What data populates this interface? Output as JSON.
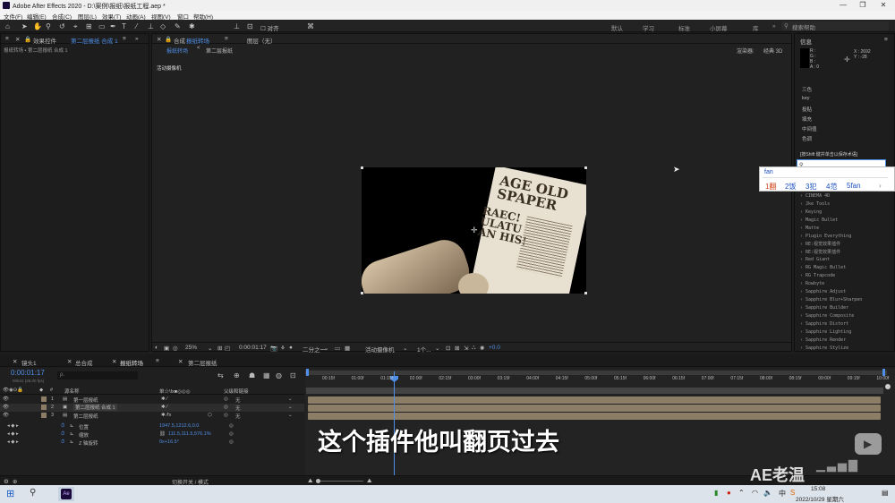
{
  "app": {
    "title": "Adobe After Effects 2020 - D:\\案例\\报纸\\报纸工程.aep *"
  },
  "window_controls": {
    "min": "—",
    "max": "❐",
    "close": "✕"
  },
  "menu": [
    "文件(F)",
    "编辑(E)",
    "合成(C)",
    "图层(L)",
    "效果(T)",
    "动画(A)",
    "视图(V)",
    "窗口",
    "帮助(H)"
  ],
  "toolbar": {
    "snap_label": "对齐",
    "workspaces": [
      "默认",
      "学习",
      "标准",
      "小屏幕",
      "库"
    ],
    "search_help": "搜索帮助"
  },
  "left_panel": {
    "tab": "效果控件",
    "tab_comp": "第二层报纸 合成 1",
    "breadcrumb": "报纸转场 • 第二层报纸 合成 1"
  },
  "comp_panel": {
    "tab_prefix": "合成",
    "tab_name": "报纸转场",
    "layer_tab": "图层（无）",
    "subtabs": [
      "报纸转场",
      "第二层报纸"
    ],
    "renderer_label": "渲染器:",
    "renderer_value": "经典 3D",
    "active_camera": "活动摄像机",
    "paper_lines": [
      "AGE OLD",
      "SPAPER",
      "RAEC!",
      "ULATU",
      "AN HIS!"
    ]
  },
  "viewer_controls": {
    "zoom": "25%",
    "timecode": "0:00:01:17",
    "resolution": "二分之一",
    "camera": "活动摄像机",
    "views": "1个...",
    "exposure": "+0.0"
  },
  "right_panel": {
    "title": "信息",
    "r": "R :",
    "g": "G :",
    "b": "B :",
    "a": "A : 0",
    "x": "X : 2692",
    "y": "Y : -28",
    "items": [
      "三色",
      "key",
      "投贴",
      "填充",
      "中间值",
      "色调"
    ],
    "hint": "[按Shift 键并单击以保存术语]"
  },
  "ime": {
    "input": "fan",
    "candidates": [
      "1翻",
      "2饭",
      "3犯",
      "4范",
      "5fan"
    ]
  },
  "effects_list": [
    "CINEMA 4D",
    "Jke Tools",
    "Keying",
    "Magic Bullet",
    "Matte",
    "Plugin Everything",
    "RE:视觉效果插件",
    "RE:视觉效果插件",
    "Red Giant",
    "RG Magic Bullet",
    "RG Trapcode",
    "Rowbyte",
    "Sapphire Adjust",
    "Sapphire Blur+Sharpen",
    "Sapphire Builder",
    "Sapphire Composite",
    "Sapphire Distort",
    "Sapphire Lighting",
    "Sapphire Render",
    "Sapphire Stylize"
  ],
  "timeline": {
    "tabs": [
      "镜头1",
      "总合成",
      "报纸转场",
      "第二层报纸"
    ],
    "timecode": "0:00:01:17",
    "fps": "00041 (25.00 fps)",
    "search_placeholder": "ρ.",
    "col_name": "源名称",
    "col_switches": "单☆\\fx■◎◎◎",
    "col_parent": "父级和链接",
    "layers": [
      {
        "num": "1",
        "name": "第一层报纸",
        "parent": "无"
      },
      {
        "num": "2",
        "name": "第二层报纸 合成 1",
        "parent": "无"
      },
      {
        "num": "3",
        "name": "第二层报纸",
        "parent": "无"
      }
    ],
    "props": [
      {
        "name": "位置",
        "value": "1947.5,1212.6,0.0"
      },
      {
        "name": "缩放",
        "value": "111.5,111.5,576.1%"
      },
      {
        "name": "Z 轴旋转",
        "value": "0x+16.5°"
      }
    ],
    "ruler": [
      "00:15f",
      "01:00f",
      "01:15f",
      "02:00f",
      "02:15f",
      "03:00f",
      "03:15f",
      "04:00f",
      "04:15f",
      "05:00f",
      "05:15f",
      "06:00f",
      "06:15f",
      "07:00f",
      "07:15f",
      "08:00f",
      "08:15f",
      "09:00f",
      "09:15f",
      "10:00f"
    ],
    "footer": "切换开关 / 模式",
    "playhead_time": "01:17"
  },
  "subtitle": "这个插件他叫翻页过去",
  "watermark": "AE老温",
  "taskbar": {
    "time": "15:08",
    "date": "2022/10/29 星期六",
    "lang": "中"
  }
}
